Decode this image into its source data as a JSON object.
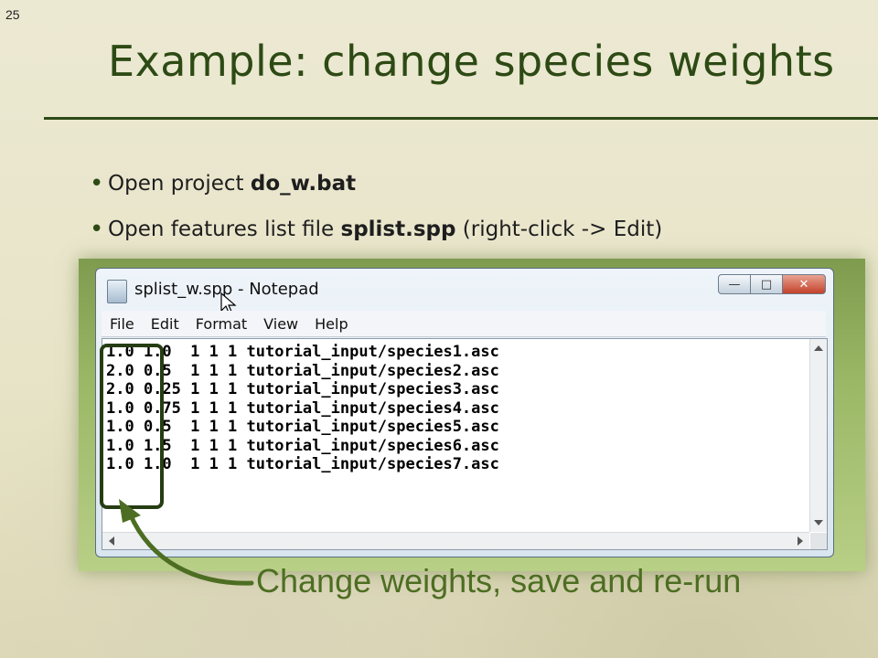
{
  "slide": {
    "number": "25",
    "title": "Example: change species weights",
    "bullets": [
      {
        "text": "Open project ",
        "bold": "do_w.bat",
        "after": ""
      },
      {
        "text": "Open features list file ",
        "bold": "splist.spp",
        "after": " (right-click -> Edit)"
      }
    ],
    "callout": "Change weights, save and re-run"
  },
  "window": {
    "title": "splist_w.spp - Notepad",
    "controls": {
      "minimize": "—",
      "maximize": "□",
      "close": "✕"
    },
    "menu": [
      "File",
      "Edit",
      "Format",
      "View",
      "Help"
    ],
    "lines": [
      "1.0 1.0  1 1 1 tutorial_input/species1.asc",
      "2.0 0.5  1 1 1 tutorial_input/species2.asc",
      "2.0 0.25 1 1 1 tutorial_input/species3.asc",
      "1.0 0.75 1 1 1 tutorial_input/species4.asc",
      "1.0 0.5  1 1 1 tutorial_input/species5.asc",
      "1.0 1.5  1 1 1 tutorial_input/species6.asc",
      "1.0 1.0  1 1 1 tutorial_input/species7.asc"
    ]
  },
  "colors": {
    "title": "#2d4a14",
    "callout": "#4d6e22",
    "highlight": "#263d14"
  },
  "icons": {
    "app": "notepad-icon",
    "cursor": "mouse-pointer-icon",
    "arrow": "curved-arrow-icon"
  }
}
